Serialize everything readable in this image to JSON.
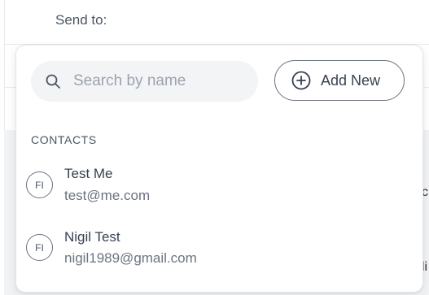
{
  "background": {
    "send_to_label": "Send to:",
    "edge_glyph_top": "c",
    "edge_glyph_bottom": "li"
  },
  "popover": {
    "search": {
      "placeholder": "Search by name",
      "value": "",
      "icon": "search-icon"
    },
    "add_button": {
      "label": "Add New",
      "icon": "plus-circle-icon"
    },
    "section_label": "CONTACTS",
    "contacts": [
      {
        "initials": "FI",
        "name": "Test Me",
        "email": "test@me.com"
      },
      {
        "initials": "FI",
        "name": "Nigil Test",
        "email": "nigil1989@gmail.com"
      }
    ]
  },
  "colors": {
    "text_primary": "#374151",
    "text_secondary": "#6b7280",
    "search_bg": "#f3f4f6",
    "border": "#e5e7eb"
  }
}
